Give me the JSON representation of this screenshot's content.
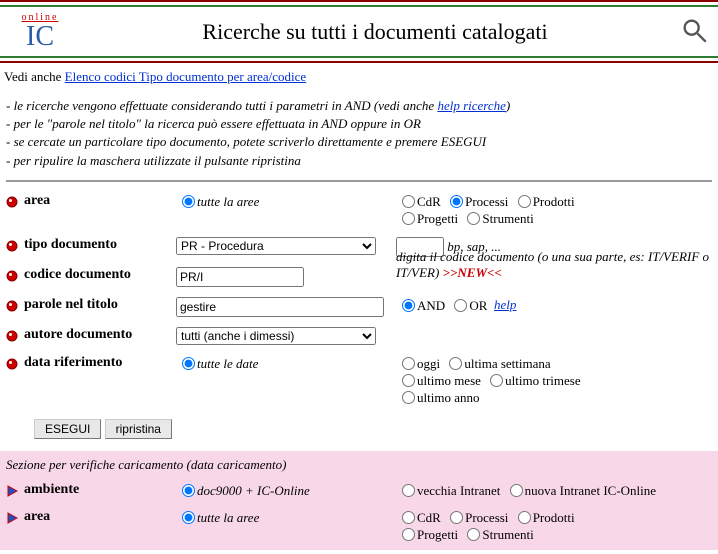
{
  "header": {
    "logo_top": "online",
    "logo_main": "IC",
    "title": "Ricerche su tutti i documenti catalogati"
  },
  "vedi": {
    "prefix": "Vedi anche ",
    "link": "Elenco codici Tipo documento per area/codice"
  },
  "hints": {
    "l1a": "- le ricerche vengono effettuate considerando tutti i parametri in AND (vedi anche ",
    "l1link": "help ricerche",
    "l1b": ")",
    "l2": "- per le \"parole nel titolo\" la ricerca può essere effettuata in AND oppure in OR",
    "l3": "- se cercate un particolare tipo documento, potete scriverlo direttamente e premere ESEGUI",
    "l4": "- per ripulire la maschera utilizzate il pulsante ripristina"
  },
  "form": {
    "area": {
      "label": "area",
      "all_label": "tutte la aree",
      "opts": {
        "cdr": "CdR",
        "processi": "Processi",
        "prodotti": "Prodotti",
        "progetti": "Progetti",
        "strumenti": "Strumenti"
      }
    },
    "tipodoc": {
      "label": "tipo documento",
      "selected": "PR - Procedura",
      "freehint": "bp, sap, ..."
    },
    "codice": {
      "label": "codice documento",
      "value": "PR/I",
      "hint1": "digita il codice documento (o una sua parte, es: IT/VERIF o IT/VER) ",
      "new": ">>NEW<<"
    },
    "parole": {
      "label": "parole nel titolo",
      "value": "gestire",
      "and": "AND",
      "or": "OR",
      "help": "help"
    },
    "autore": {
      "label": "autore documento",
      "selected": "tutti (anche i dimessi)"
    },
    "datarif": {
      "label": "data riferimento",
      "all_label": "tutte le date",
      "opts": {
        "oggi": "oggi",
        "settimana": "ultima settimana",
        "mese": "ultimo mese",
        "trimese": "ultimo trimese",
        "anno": "ultimo anno"
      }
    }
  },
  "buttons": {
    "esegui": "ESEGUI",
    "ripristina": "ripristina"
  },
  "section2": {
    "title": "Sezione per verifiche caricamento (data caricamento)",
    "ambiente": {
      "label": "ambiente",
      "opt_sel": "doc9000 + IC-Online",
      "opt_a": "vecchia Intranet",
      "opt_b": "nuova Intranet IC-Online"
    },
    "area": {
      "label": "area",
      "all_label": "tutte la aree",
      "opts": {
        "cdr": "CdR",
        "processi": "Processi",
        "prodotti": "Prodotti",
        "progetti": "Progetti",
        "strumenti": "Strumenti"
      }
    }
  }
}
